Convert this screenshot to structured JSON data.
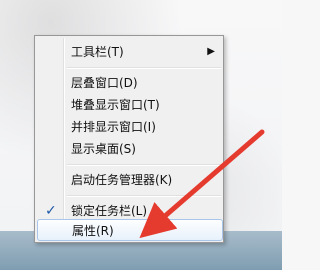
{
  "context_menu": {
    "items": [
      {
        "label": "工具栏(T)",
        "has_submenu": true
      },
      {
        "label": "层叠窗口(D)"
      },
      {
        "label": "堆叠显示窗口(T)"
      },
      {
        "label": "并排显示窗口(I)"
      },
      {
        "label": "显示桌面(S)"
      },
      {
        "label": "启动任务管理器(K)"
      },
      {
        "label": "锁定任务栏(L)",
        "checked": true
      },
      {
        "label": "属性(R)",
        "highlighted": true
      }
    ],
    "icons": {
      "submenu_arrow": "chevron-right-icon",
      "check": "checkmark-icon"
    },
    "colors": {
      "highlight_border": "#a9c6ea",
      "check": "#1f5aa6",
      "annotation_arrow": "#e53b2f",
      "taskbar": "#8ea7b8"
    }
  }
}
